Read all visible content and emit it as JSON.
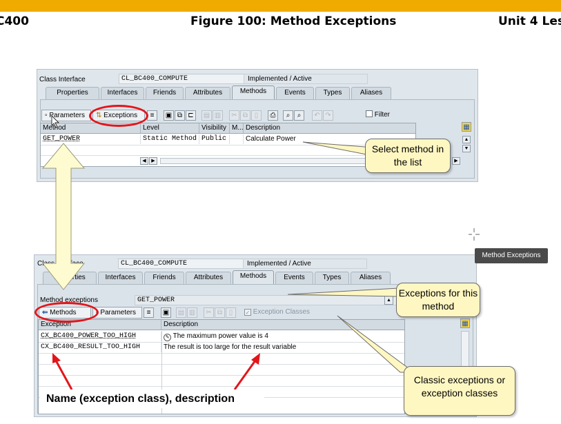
{
  "header": {
    "left": "C400",
    "center": "Figure 100: Method Exceptions",
    "right": "Unit 4 Les"
  },
  "screen1": {
    "class_interface_label": "Class Interface",
    "class_name": "CL_BC400_COMPUTE",
    "status": "Implemented / Active",
    "tabs": [
      "Properties",
      "Interfaces",
      "Friends",
      "Attributes",
      "Methods",
      "Events",
      "Types",
      "Aliases"
    ],
    "active_tab": "Methods",
    "toolbar": {
      "parameters": "Parameters",
      "exceptions": "Exceptions",
      "filter": "Filter"
    },
    "columns": [
      "Method",
      "Level",
      "Visibility",
      "M...",
      "Description"
    ],
    "rows": [
      {
        "method": "GET_POWER",
        "level": "Static Method",
        "visibility": "Public",
        "m": "",
        "description": "Calculate Power"
      }
    ]
  },
  "screen2": {
    "class_interface_label": "Class Interface",
    "class_name": "CL_BC400_COMPUTE",
    "status": "Implemented / Active",
    "tabs": [
      "Properties",
      "Interfaces",
      "Friends",
      "Attributes",
      "Methods",
      "Events",
      "Types",
      "Aliases"
    ],
    "active_tab": "Methods",
    "method_exceptions_label": "Method exceptions",
    "method_name": "GET_POWER",
    "toolbar": {
      "methods": "Methods",
      "parameters": "Parameters",
      "exception_classes": "Exception Classes"
    },
    "columns": [
      "Exception",
      "Description"
    ],
    "rows": [
      {
        "exception": "CX_BC400_POWER_TOO_HIGH",
        "description": "The maximum power value is 4"
      },
      {
        "exception": "CX_BC400_RESULT_TOO_HIGH",
        "description": "The result is too large for the result variable"
      }
    ]
  },
  "callouts": {
    "select_method": "Select method in the list",
    "exceptions_for": "Exceptions for this method",
    "classic": "Classic exceptions or exception classes",
    "name_desc": "Name (exception class), description"
  },
  "tooltip": "Method Exceptions",
  "colors": {
    "accent_bar": "#f0ab00",
    "highlight_ring": "#e2151b",
    "callout_fill": "#fff7c2",
    "arrow_fill": "#fffbd0"
  },
  "icons": [
    "save-icon",
    "copy-icon",
    "tree-icon",
    "cut-icon",
    "print-icon",
    "find-icon",
    "layout-icon",
    "back-arrow-icon",
    "crosshair-icon"
  ]
}
